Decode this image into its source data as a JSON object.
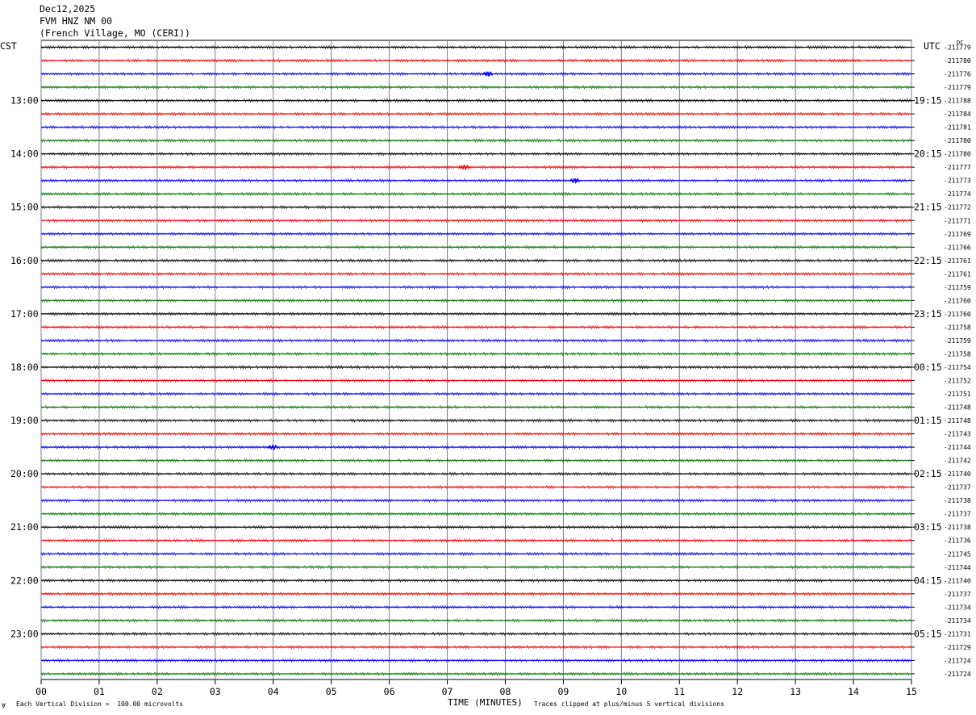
{
  "header": {
    "date": "Dec12,2025",
    "station": "FVM HNZ NM 00",
    "location": "(French Village, MO (CERI))"
  },
  "left_zone_label": "CST",
  "right_zone_label": "UTC",
  "dc_label": "DC",
  "footer": {
    "scale_note": "Each Vertical Division =  100.00 microvolts",
    "clip_note": "Traces clipped at plus/minus 5 vertical divisions",
    "corner_mark": "∀"
  },
  "colors": {
    "trace_cycle": [
      "#000000",
      "#ff0000",
      "#0000ff",
      "#007700"
    ],
    "grid": "#7a7a9a"
  },
  "chart_data": {
    "type": "line",
    "xlabel": "TIME (MINUTES)",
    "xlim": [
      0,
      15
    ],
    "x_tick_labels": [
      "00",
      "01",
      "02",
      "03",
      "04",
      "05",
      "06",
      "07",
      "08",
      "09",
      "10",
      "11",
      "12",
      "13",
      "14",
      "15"
    ],
    "left_time_labels": [
      "13:00",
      "14:00",
      "15:00",
      "16:00",
      "17:00",
      "18:00",
      "19:00",
      "20:00",
      "21:00",
      "22:00",
      "23:00"
    ],
    "right_time_labels": [
      "19:15",
      "20:15",
      "21:15",
      "22:15",
      "23:15",
      "00:15",
      "01:15",
      "02:15",
      "03:15",
      "04:15",
      "05:15"
    ],
    "traces_per_hour": 4,
    "first_labeled_trace": 4,
    "dc_offsets": [
      "-211779",
      "-211780",
      "-211776",
      "-211779",
      "-211788",
      "-211784",
      "-211781",
      "-211780",
      "-211780",
      "-211777",
      "-211773",
      "-211774",
      "-211772",
      "-211771",
      "-211769",
      "-211766",
      "-211761",
      "-211761",
      "-211759",
      "-211760",
      "-211760",
      "-211758",
      "-211759",
      "-211758",
      "-211754",
      "-211752",
      "-211751",
      "-211748",
      "-211748",
      "-211743",
      "-211744",
      "-211742",
      "-211740",
      "-211737",
      "-211738",
      "-211737",
      "-211738",
      "-211736",
      "-211745",
      "-211744",
      "-211740",
      "-211737",
      "-211734",
      "-211734",
      "-211731",
      "-211729",
      "-211724",
      "-211724"
    ],
    "notable_events": [
      {
        "trace": 2,
        "minute": 7.7
      },
      {
        "trace": 9,
        "minute": 7.3
      },
      {
        "trace": 10,
        "minute": 9.2
      },
      {
        "trace": 30,
        "minute": 4.0
      }
    ]
  }
}
